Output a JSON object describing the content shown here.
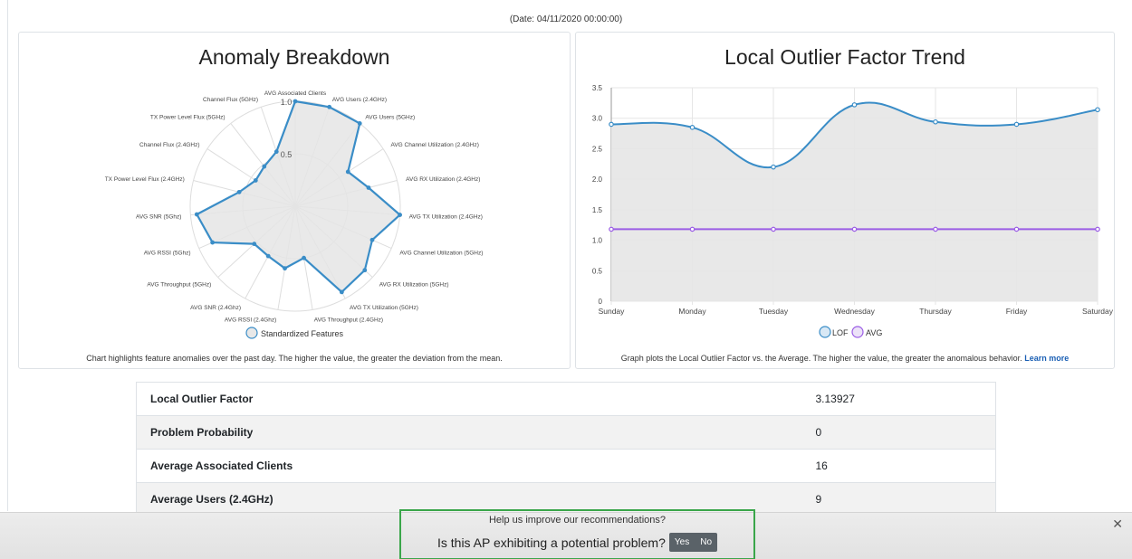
{
  "date_line": "(Date: 04/11/2020 00:00:00)",
  "radar": {
    "title": "Anomaly Breakdown",
    "caption": "Chart highlights feature anomalies over the past day. The higher the value, the greater the deviation from the mean.",
    "legend": "Standardized Features",
    "tick_labels": [
      "1.0",
      "0.5"
    ],
    "colors": {
      "line": "#3a8dc7",
      "fill": "#e5e5e5",
      "grid": "#dddddd"
    }
  },
  "line_chart": {
    "title": "Local Outlier Factor Trend",
    "caption_text": "Graph plots the Local Outlier Factor vs. the Average. The higher the value, the greater the anomalous behavior.",
    "caption_link": "Learn more",
    "colors": {
      "lof": "#3a8dc7",
      "avg": "#9b5de5",
      "fill": "#e5e5e5"
    }
  },
  "chart_data": [
    {
      "type": "radar",
      "title": "Anomaly Breakdown",
      "categories": [
        "AVG Associated Clients",
        "AVG Users (2.4GHz)",
        "AVG Users (5GHz)",
        "AVG Channel Utilization (2.4GHz)",
        "AVG RX Utilization (2.4GHz)",
        "AVG TX Utilization (2.4GHz)",
        "AVG Channel Utilization (5GHz)",
        "AVG RX Utilization (5GHz)",
        "AVG TX Utilization (5GHz)",
        "AVG Throughput (2.4GHz)",
        "AVG RSSI (2.4Ghz)",
        "AVG SNR (2.4Ghz)",
        "AVG Throughput (5GHz)",
        "AVG RSSI (5Ghz)",
        "AVG SNR (5Ghz)",
        "TX Power Level Flux (2.4GHz)",
        "Channel Flux (2.4GHz)",
        "TX Power Level Flux (5GHz)",
        "Channel Flux (5GHz)"
      ],
      "series": [
        {
          "name": "Standardized Features",
          "values": [
            1.0,
            1.0,
            1.0,
            0.6,
            0.72,
            1.0,
            0.8,
            0.9,
            0.93,
            0.5,
            0.6,
            0.54,
            0.53,
            0.86,
            0.94,
            0.55,
            0.45,
            0.48,
            0.55
          ]
        }
      ],
      "rlim": [
        0,
        1.0
      ]
    },
    {
      "type": "line",
      "title": "Local Outlier Factor Trend",
      "categories": [
        "Sunday",
        "Monday",
        "Tuesday",
        "Wednesday",
        "Thursday",
        "Friday",
        "Saturday"
      ],
      "series": [
        {
          "name": "LOF",
          "values": [
            2.9,
            2.85,
            2.2,
            3.22,
            2.94,
            2.9,
            3.14
          ]
        },
        {
          "name": "AVG",
          "values": [
            1.18,
            1.18,
            1.18,
            1.18,
            1.18,
            1.18,
            1.18
          ]
        }
      ],
      "ylim": [
        0,
        3.5
      ],
      "yticks": [
        0,
        0.5,
        1.0,
        1.5,
        2.0,
        2.5,
        3.0,
        3.5
      ],
      "ytick_labels": [
        "0",
        "0.5",
        "1.0",
        "1.5",
        "2.0",
        "2.5",
        "3.0",
        "3.5"
      ],
      "grid": true,
      "legend_position": "bottom"
    }
  ],
  "table": [
    {
      "label": "Local Outlier Factor",
      "value": "3.13927"
    },
    {
      "label": "Problem Probability",
      "value": "0"
    },
    {
      "label": "Average Associated Clients",
      "value": "16"
    },
    {
      "label": "Average Users (2.4GHz)",
      "value": "9"
    }
  ],
  "feedback": {
    "help": "Help us improve our recommendations?",
    "question": "Is this AP exhibiting a potential problem?",
    "yes": "Yes",
    "no": "No",
    "close_icon": "close-icon",
    "highlight_color": "#3aa64a"
  }
}
